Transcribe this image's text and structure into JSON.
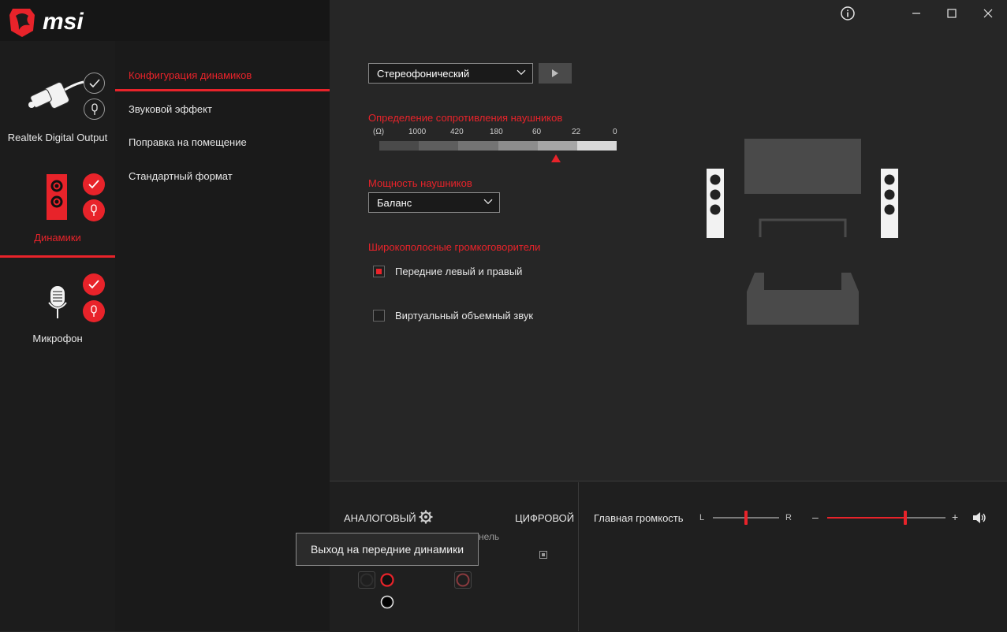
{
  "app": {
    "brand": "msi"
  },
  "window": {
    "info_icon": "info-icon",
    "minimize_icon": "minimize-icon",
    "maximize_icon": "maximize-icon",
    "close_icon": "close-icon"
  },
  "devices": [
    {
      "label": "Realtek Digital Output",
      "icon": "digital-output-plug-icon",
      "active": false
    },
    {
      "label": "Динамики",
      "icon": "speaker-icon",
      "active": true
    },
    {
      "label": "Микрофон",
      "icon": "microphone-icon",
      "active": false
    }
  ],
  "menu": {
    "items": [
      {
        "label": "Конфигурация динамиков",
        "active": true
      },
      {
        "label": "Звуковой эффект",
        "active": false
      },
      {
        "label": "Поправка на помещение",
        "active": false
      },
      {
        "label": "Стандартный формат",
        "active": false
      }
    ]
  },
  "speaker_config": {
    "dropdown_value": "Стереофонический",
    "impedance_title": "Определение сопротивления наушников",
    "impedance_ticks": [
      "(Ω)",
      "1000",
      "420",
      "180",
      "60",
      "22",
      "0"
    ],
    "headphone_power_title": "Мощность наушников",
    "headphone_power_value": "Баланс",
    "fullrange_title": "Широкополосные громкоговорители",
    "options": [
      {
        "label": "Передние левый и правый",
        "checked": true
      },
      {
        "label": "Виртуальный объемный звук",
        "checked": false
      }
    ]
  },
  "bottom": {
    "analog_label": "АНАЛОГОВЫЙ",
    "digital_label": "ЦИФРОВОЙ",
    "panel_partial": "нель",
    "tooltip": "Выход на передние динамики",
    "master_volume_label": "Главная громкость",
    "balance_left": "L",
    "balance_right": "R",
    "volume_minus": "–",
    "volume_plus": "+",
    "balance_value": 0.5,
    "volume_value": 0.66
  },
  "colors": {
    "accent": "#e8232a",
    "background": "#262626",
    "panel": "#1a1a1a"
  }
}
